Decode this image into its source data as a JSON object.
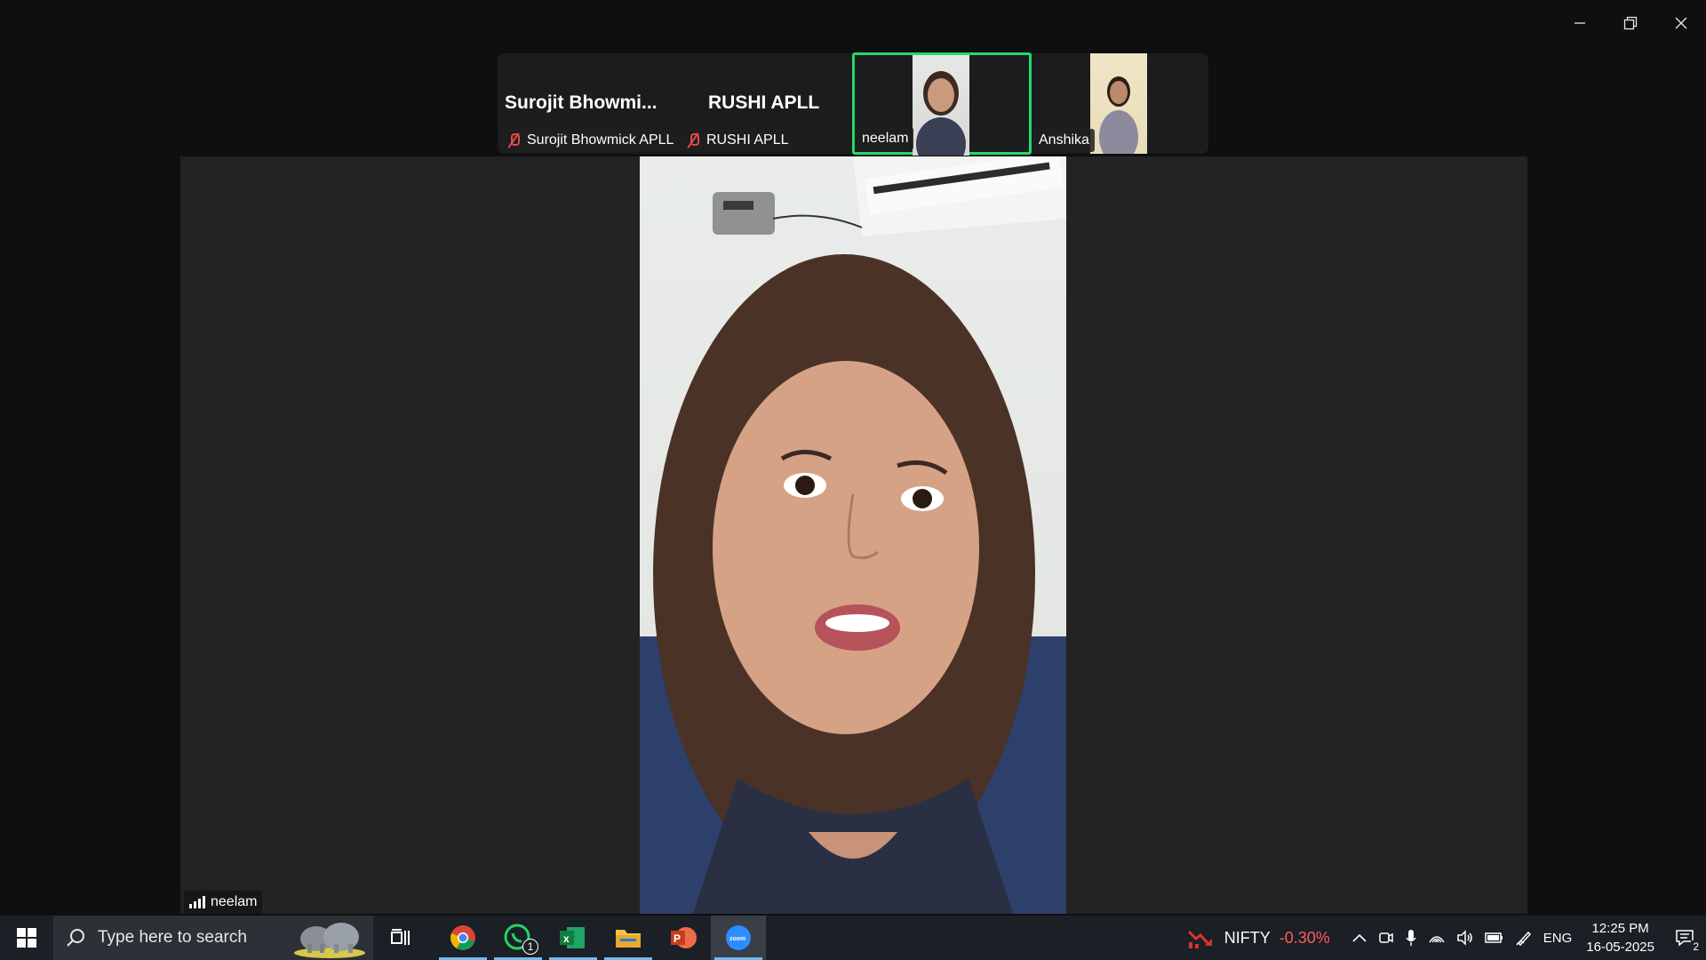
{
  "window": {
    "minimize_label": "Minimize",
    "restore_label": "Restore",
    "close_label": "Close"
  },
  "participants": [
    {
      "display_name": "Surojit  Bhowmi...",
      "chip_name": "Surojit Bhowmick APLL",
      "muted": true
    },
    {
      "display_name": "RUSHI APLL",
      "chip_name": "RUSHI APLL",
      "muted": true
    },
    {
      "chip_name": "neelam",
      "video": true,
      "active_speaker": true
    },
    {
      "chip_name": "Anshika",
      "video": true
    }
  ],
  "main_video": {
    "speaker_name": "neelam"
  },
  "taskbar": {
    "search_placeholder": "Type here to search",
    "whatsapp_badge": "1",
    "stock_ticker": "NIFTY",
    "stock_change": "-0.30%",
    "language": "ENG",
    "time": "12:25 PM",
    "date": "16-05-2025",
    "notification_count": "2"
  },
  "colors": {
    "active_speaker_border": "#23d96b",
    "muted_red": "#e5484d",
    "stock_negative": "#ff5b5b",
    "taskbar_bg": "#1b1f26"
  }
}
